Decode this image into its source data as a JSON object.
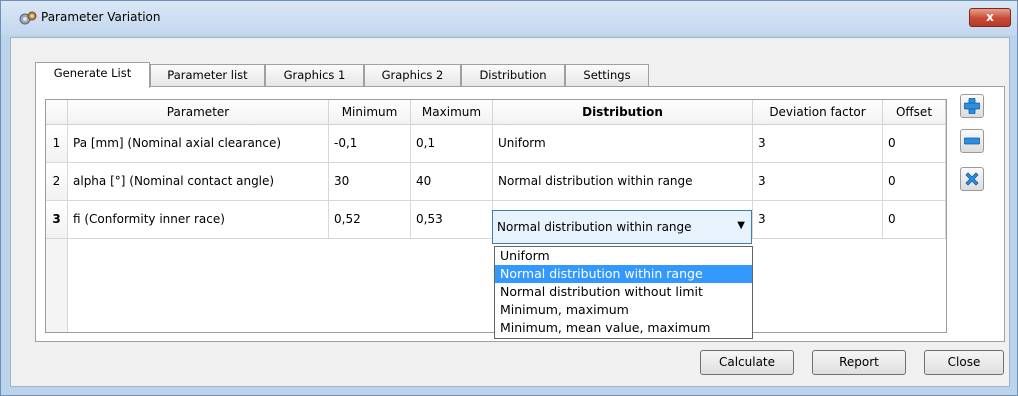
{
  "window": {
    "title": "Parameter Variation",
    "close_label": "x"
  },
  "tabs": [
    "Generate List",
    "Parameter list",
    "Graphics 1",
    "Graphics 2",
    "Distribution",
    "Settings"
  ],
  "table": {
    "headers": [
      "Parameter",
      "Minimum",
      "Maximum",
      "Distribution",
      "Deviation factor",
      "Offset"
    ],
    "rows": [
      {
        "num": "1",
        "parameter": "Pa [mm]  (Nominal axial clearance)",
        "min": "-0,1",
        "max": "0,1",
        "distribution": "Uniform",
        "deviation": "3",
        "offset": "0"
      },
      {
        "num": "2",
        "parameter": "alpha [°]  (Nominal contact angle)",
        "min": "30",
        "max": "40",
        "distribution": "Normal distribution within range",
        "deviation": "3",
        "offset": "0"
      },
      {
        "num": "3",
        "parameter": "fi (Conformity inner race)",
        "min": "0,52",
        "max": "0,53",
        "distribution": "Normal distribution within range",
        "deviation": "3",
        "offset": "0"
      }
    ]
  },
  "dropdown": {
    "options": [
      "Uniform",
      "Normal distribution within range",
      "Normal distribution without limit",
      "Minimum, maximum",
      "Minimum, mean value, maximum"
    ],
    "selected_index": 1
  },
  "side_buttons": {
    "add": "add-icon",
    "remove": "remove-icon",
    "delete": "delete-icon"
  },
  "buttons": {
    "calculate": "Calculate",
    "report": "Report",
    "close": "Close"
  },
  "colors": {
    "selection": "#3399ff",
    "title_bar": "#c3d7ee",
    "add_icon": "#2d8ee0",
    "close_red": "#c74a35"
  }
}
